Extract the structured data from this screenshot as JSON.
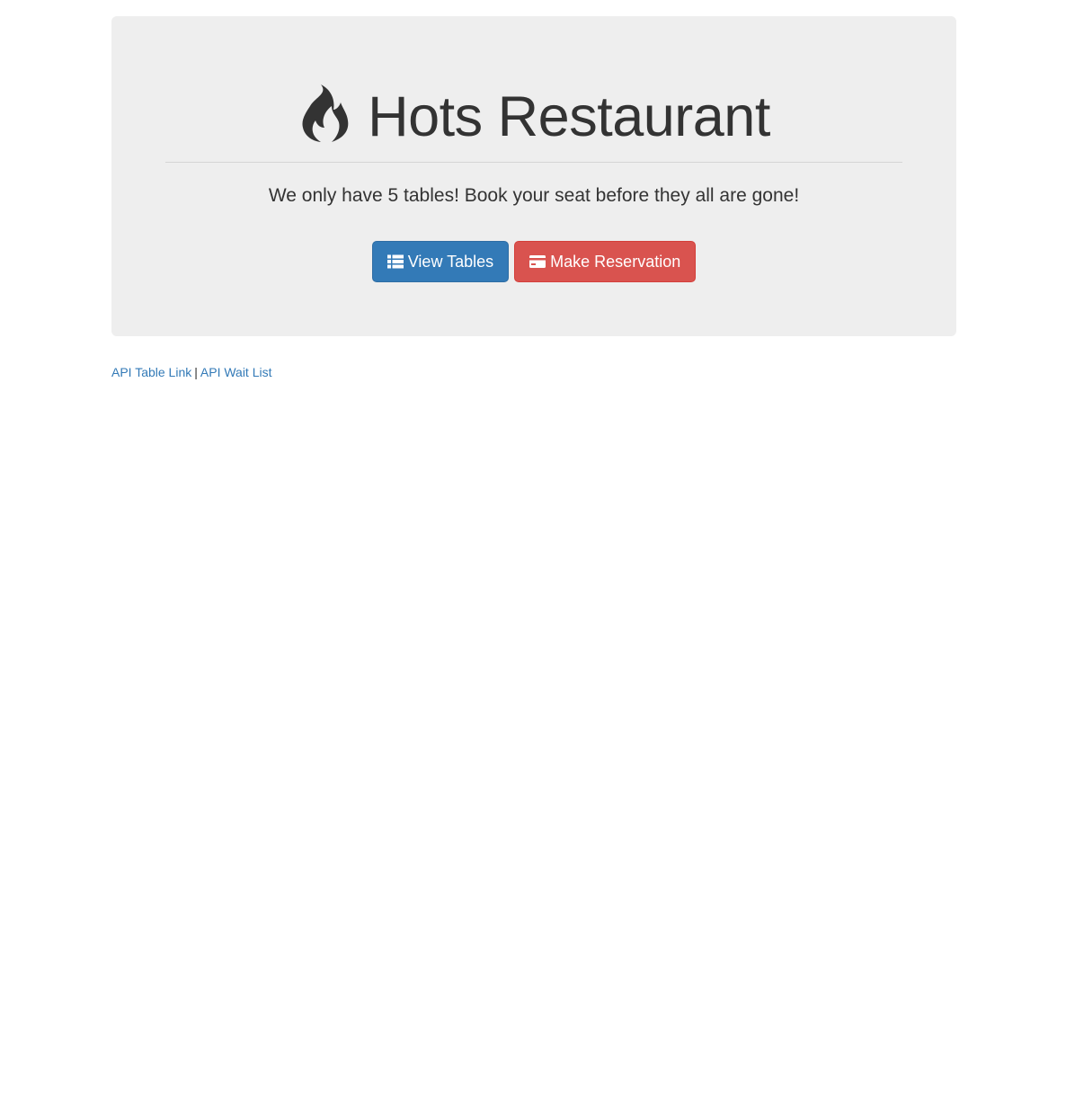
{
  "header": {
    "title": "Hots Restaurant",
    "icon": "fire-icon",
    "tagline": "We only have 5 tables! Book your seat before they all are gone!"
  },
  "actions": {
    "view_tables": {
      "label": "View Tables",
      "icon": "list-icon",
      "color": "#337ab7"
    },
    "make_reservation": {
      "label": "Make Reservation",
      "icon": "credit-card-icon",
      "color": "#d9534f"
    }
  },
  "footer_links": {
    "api_table": "API Table Link",
    "separator": "|",
    "api_wait": "API Wait List",
    "link_color": "#337ab7"
  },
  "colors": {
    "jumbotron_bg": "#eeeeee",
    "text": "#333333"
  }
}
